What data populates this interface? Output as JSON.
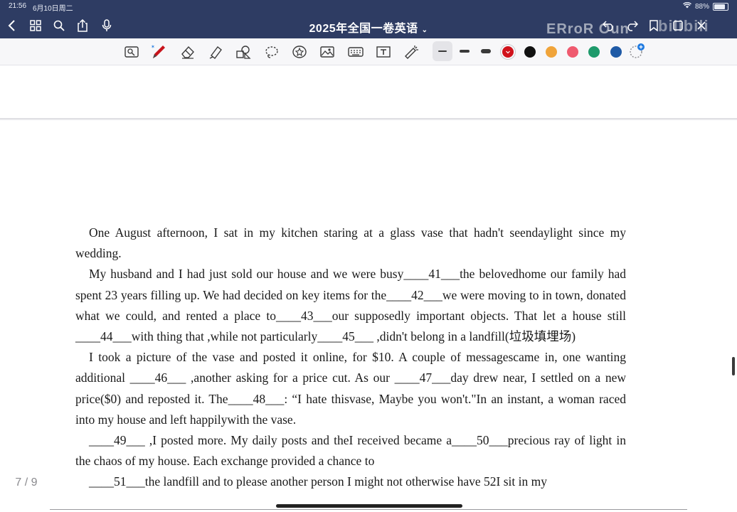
{
  "status_bar": {
    "time": "21:56",
    "date": "6月10日周二",
    "battery": "88%"
  },
  "nav": {
    "title": "2025年全国一卷英语",
    "icons": [
      "back-icon",
      "grid-icon",
      "search-icon",
      "share-icon",
      "mic-icon",
      "undo-icon",
      "redo-icon",
      "bookmark-icon",
      "more-icon",
      "close-icon"
    ]
  },
  "watermark": {
    "text1": "ERroR Oun",
    "text2": "bilibili"
  },
  "toolbar": {
    "tools": [
      "lasso-image-icon",
      "pen-icon",
      "eraser-icon",
      "highlighter-icon",
      "shape-icon",
      "lasso-icon",
      "sticker-icon",
      "image-icon",
      "keyboard-icon",
      "textbox-icon",
      "laser-pointer-icon"
    ],
    "colors": [
      "#d0121b",
      "#111111",
      "#f0a43a",
      "#ef5a6f",
      "#1e9a6b",
      "#1f5aa6"
    ]
  },
  "content": {
    "paragraphs": [
      "One August afternoon, I sat in my kitchen staring at a glass vase that hadn't seendaylight since my wedding.",
      "My husband and I had just sold our house and we were busy____41___the belovedhome our family had spent 23 years filling up. We had decided on key items for the____42___we were moving to in town, donated what we could, and rented a place to____43___our supposedly important objects. That let a house still ____44___with thing that ,while not particularly____45___ ,didn't belong in a landfill(垃圾填埋场)",
      "I took a picture of the vase and posted it online, for $10. A couple of messagescame in, one wanting additional ____46___ ,another asking for a price cut. As our ____47___day drew near, I settled on a new price($0) and reposted it. The____48___: “I hate thisvase, Maybe you won't.\"In an instant, a woman raced into my house and left happilywith the vase.",
      "____49___ ,I posted more. My daily posts and theI received became a____50___precious ray of light in the chaos of my house. Each exchange provided a chance to",
      "____51___the landfill and to please another person I might not otherwise have 52I sit in my"
    ]
  },
  "page_indicator": "7 / 9"
}
